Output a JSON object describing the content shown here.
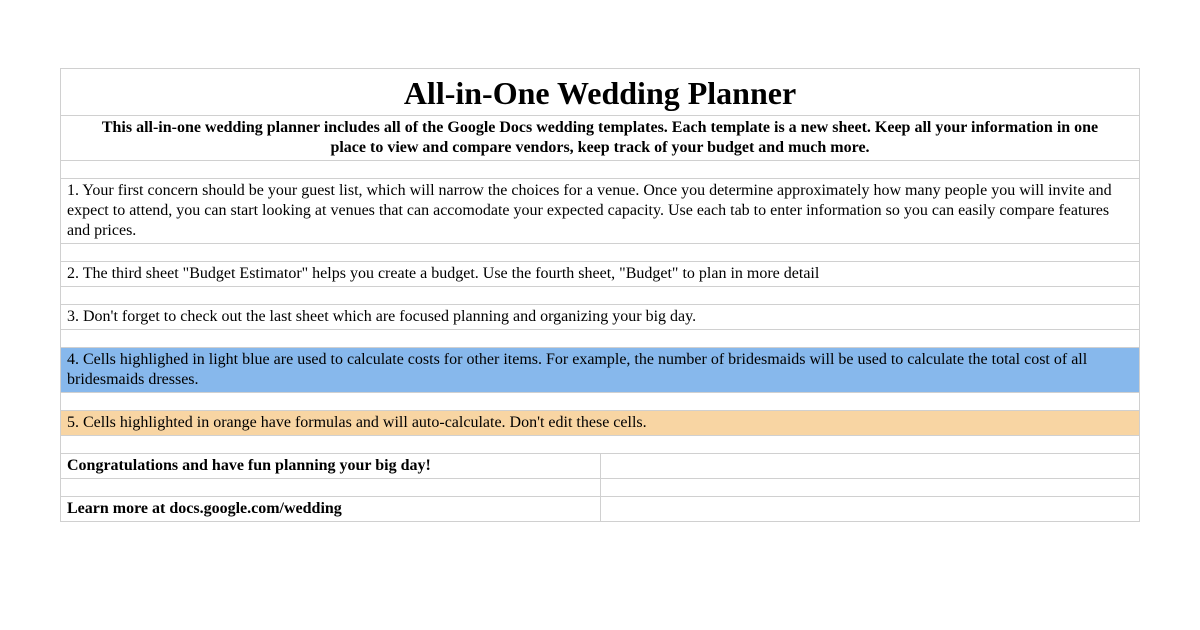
{
  "title": "All-in-One Wedding Planner",
  "subtitle": "This all-in-one wedding planner includes all of the Google Docs wedding templates.  Each template is a new sheet.  Keep all your information in one place to view and compare vendors, keep track of your budget and much more.",
  "items": {
    "step1": "1.  Your first concern should be your guest list, which will narrow the choices for a venue. Once you determine approximately how many people you will invite and expect to attend, you can start looking at venues that can accomodate your expected capacity. Use each tab to enter information so you can easily compare features and prices.",
    "step2": "2.  The third sheet \"Budget Estimator\" helps you create a budget.  Use the fourth sheet, \"Budget\" to plan in more detail",
    "step3": "3.  Don't forget to check out the last sheet which are focused planning and organizing your big day.",
    "step4": "4. Cells highlighed in light blue are used to calculate costs for other items. For example, the number of bridesmaids will be used to calculate the total cost of all bridesmaids dresses.",
    "step5": "5. Cells highlighted in orange have formulas and will auto-calculate. Don't edit these cells."
  },
  "footer": {
    "congrats": "Congratulations and have fun planning your big day!",
    "learn_more": "Learn more at docs.google.com/wedding"
  },
  "colors": {
    "highlight_blue": "#87b8ec",
    "highlight_orange": "#f8d5a3",
    "border": "#d0d0d0"
  }
}
